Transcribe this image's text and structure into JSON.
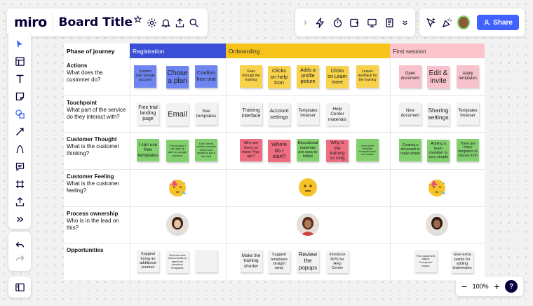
{
  "app": {
    "logo": "miro",
    "board_title": "Board Title",
    "share_label": "Share"
  },
  "zoom": {
    "level": "100%",
    "minus": "−",
    "plus": "+",
    "help": "?"
  },
  "colors": {
    "accent": "#4262ff",
    "registration": "#3b4fd6",
    "onboarding": "#f7c319",
    "first_session": "#fbc5cb",
    "blue_note": "#6f86f2",
    "yellow_note": "#f7d24a",
    "pink_note": "#f7c2cb",
    "red_note": "#ef6d80",
    "green_note": "#82cf6e",
    "white_note": "#f2f2f2"
  },
  "journey": {
    "phase_header": "Phase of journey",
    "phases": [
      "Registration",
      "Onboarding",
      "First session"
    ],
    "rows": [
      {
        "title": "Actions",
        "subtitle": "What does the customer do?"
      },
      {
        "title": "Touchpoint",
        "subtitle": "What part of the service do they interact with?"
      },
      {
        "title": "Customer Thought",
        "subtitle": "What is the customer thinking?"
      },
      {
        "title": "Customer Feeling",
        "subtitle": "What is the customer feeling?"
      },
      {
        "title": "Process ownership",
        "subtitle": "Who is in the lead on this?"
      },
      {
        "title": "Opportunities",
        "subtitle": ""
      }
    ],
    "notes": {
      "actions": {
        "registration": [
          "Connect their Google account",
          "Chose a plan",
          "Confirm free trial"
        ],
        "onboarding": [
          "Goes through the training",
          "Clicks on help icon",
          "Adds a profile picture",
          "Clicks on Learn more",
          "Leaves feedback for the training"
        ],
        "first_session": [
          "Open document",
          "Edit & invite",
          "Apply templates"
        ]
      },
      "touchpoint": {
        "registration": [
          "Free trial landing page",
          "Email",
          "free templates"
        ],
        "onboarding": [
          "Training interface",
          "Account settings",
          "Templates browser",
          "Help Center materials"
        ],
        "first_session": [
          "New document",
          "Sharing settings",
          "Templates browser"
        ]
      },
      "thought": {
        "registration": [
          "I can use free templates",
          "This is easy, I can sign up with my google account",
          "Don't seem need to provide credit card details to get a free trial"
        ],
        "onboarding": [
          "Why are there so many Pop-ups?",
          "Where do I start?",
          "Educational materials are easy to follow",
          "Why is the training so long",
          "I love all the template examples that I can browse"
        ],
        "first_session": [
          "Creating a document is really simple",
          "Adding a team member is very simple",
          "There are many templates to choose from"
        ]
      },
      "opportunities": {
        "registration": [
          "Suggest trying an additional product",
          "Give the user extra credits to spend on premium templates",
          ""
        ],
        "onboarding": [
          "Make the training shorter",
          "Suggest templates straight away",
          "Review the popups",
          "Introduce NPS for Help Center"
        ],
        "first_session": [
          "Fine document adjust \"Compose\" popup",
          "Give extra points for adding teammates"
        ]
      }
    },
    "feelings": [
      "party-face-emoji",
      "neutral-face-emoji",
      "party-face-emoji"
    ],
    "owners": [
      "owner-avatar-1",
      "owner-avatar-2",
      "owner-avatar-3"
    ]
  }
}
